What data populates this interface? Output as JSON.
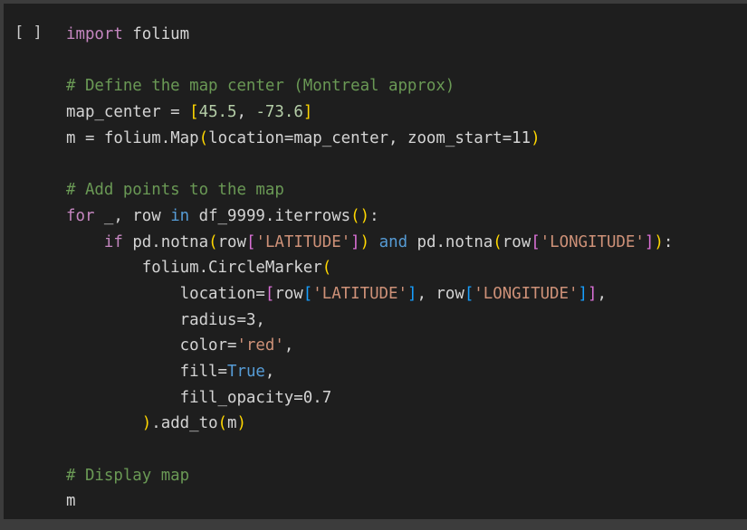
{
  "cell": {
    "run_indicator": "[ ]",
    "lines": [
      [
        {
          "t": "import",
          "c": "kwc"
        },
        {
          "t": " folium",
          "c": "plain"
        }
      ],
      [],
      [
        {
          "t": "# Define the map center (Montreal approx)",
          "c": "cmt"
        }
      ],
      [
        {
          "t": "map_center",
          "c": "plain"
        },
        {
          "t": " = ",
          "c": "plain"
        },
        {
          "t": "[",
          "c": "b1"
        },
        {
          "t": "45.5",
          "c": "num"
        },
        {
          "t": ", ",
          "c": "plain"
        },
        {
          "t": "-73.6",
          "c": "num"
        },
        {
          "t": "]",
          "c": "b1"
        }
      ],
      [
        {
          "t": "m",
          "c": "plain"
        },
        {
          "t": " = folium.",
          "c": "plain"
        },
        {
          "t": "Map",
          "c": "plain"
        },
        {
          "t": "(",
          "c": "b1"
        },
        {
          "t": "location",
          "c": "plain"
        },
        {
          "t": "=map_center, ",
          "c": "plain"
        },
        {
          "t": "zoom_start",
          "c": "plain"
        },
        {
          "t": "=",
          "c": "plain"
        },
        {
          "t": "11",
          "c": "plain"
        },
        {
          "t": ")",
          "c": "b1"
        }
      ],
      [],
      [
        {
          "t": "# Add points to the map",
          "c": "cmt"
        }
      ],
      [
        {
          "t": "for",
          "c": "kwc"
        },
        {
          "t": " _, row ",
          "c": "plain"
        },
        {
          "t": "in",
          "c": "kw"
        },
        {
          "t": " df_9999.iterrows",
          "c": "plain"
        },
        {
          "t": "(",
          "c": "b1"
        },
        {
          "t": ")",
          "c": "b1"
        },
        {
          "t": ":",
          "c": "plain"
        }
      ],
      [
        {
          "t": "    ",
          "c": "plain"
        },
        {
          "t": "if",
          "c": "kwc"
        },
        {
          "t": " pd.notna",
          "c": "plain"
        },
        {
          "t": "(",
          "c": "b1"
        },
        {
          "t": "row",
          "c": "plain"
        },
        {
          "t": "[",
          "c": "b2"
        },
        {
          "t": "'LATITUDE'",
          "c": "str"
        },
        {
          "t": "]",
          "c": "b2"
        },
        {
          "t": ")",
          "c": "b1"
        },
        {
          "t": " ",
          "c": "plain"
        },
        {
          "t": "and",
          "c": "kw"
        },
        {
          "t": " pd.notna",
          "c": "plain"
        },
        {
          "t": "(",
          "c": "b1"
        },
        {
          "t": "row",
          "c": "plain"
        },
        {
          "t": "[",
          "c": "b2"
        },
        {
          "t": "'LONGITUDE'",
          "c": "str"
        },
        {
          "t": "]",
          "c": "b2"
        },
        {
          "t": ")",
          "c": "b1"
        },
        {
          "t": ":",
          "c": "plain"
        }
      ],
      [
        {
          "t": "        folium.CircleMarker",
          "c": "plain"
        },
        {
          "t": "(",
          "c": "b1"
        }
      ],
      [
        {
          "t": "            location=",
          "c": "plain"
        },
        {
          "t": "[",
          "c": "b2"
        },
        {
          "t": "row",
          "c": "plain"
        },
        {
          "t": "[",
          "c": "b3"
        },
        {
          "t": "'LATITUDE'",
          "c": "str"
        },
        {
          "t": "]",
          "c": "b3"
        },
        {
          "t": ", row",
          "c": "plain"
        },
        {
          "t": "[",
          "c": "b3"
        },
        {
          "t": "'LONGITUDE'",
          "c": "str"
        },
        {
          "t": "]",
          "c": "b3"
        },
        {
          "t": "]",
          "c": "b2"
        },
        {
          "t": ",",
          "c": "plain"
        }
      ],
      [
        {
          "t": "            radius=",
          "c": "plain"
        },
        {
          "t": "3",
          "c": "plain"
        },
        {
          "t": ",",
          "c": "plain"
        }
      ],
      [
        {
          "t": "            color=",
          "c": "plain"
        },
        {
          "t": "'red'",
          "c": "str"
        },
        {
          "t": ",",
          "c": "plain"
        }
      ],
      [
        {
          "t": "            fill=",
          "c": "plain"
        },
        {
          "t": "True",
          "c": "kw"
        },
        {
          "t": ",",
          "c": "plain"
        }
      ],
      [
        {
          "t": "            fill_opacity=",
          "c": "plain"
        },
        {
          "t": "0.7",
          "c": "plain"
        }
      ],
      [
        {
          "t": "        ",
          "c": "plain"
        },
        {
          "t": ")",
          "c": "b1"
        },
        {
          "t": ".add_to",
          "c": "plain"
        },
        {
          "t": "(",
          "c": "b1"
        },
        {
          "t": "m",
          "c": "plain"
        },
        {
          "t": ")",
          "c": "b1"
        }
      ],
      [],
      [
        {
          "t": "# Display map",
          "c": "cmt"
        }
      ],
      [
        {
          "t": "m",
          "c": "plain"
        }
      ]
    ]
  },
  "colors": {
    "background": "#1e1e1e",
    "frame": "#3c3c3c",
    "comment": "#6a9955",
    "keyword_control": "#c586c0",
    "keyword": "#569cd6",
    "string": "#ce9178",
    "number": "#b5cea8",
    "bracket_level_1": "#ffd700",
    "bracket_level_2": "#da70d6",
    "bracket_level_3": "#179fff"
  }
}
